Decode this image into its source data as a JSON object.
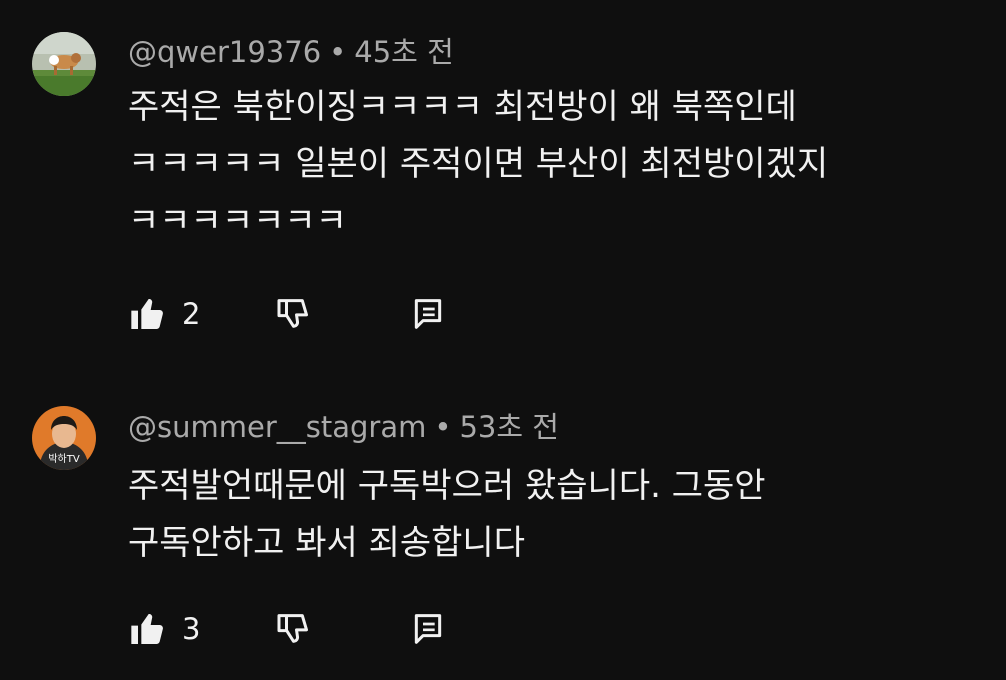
{
  "comments": [
    {
      "author": "@qwer19376",
      "separator": "•",
      "time": "45초 전",
      "lines": [
        "주적은 북한이징ㅋㅋㅋㅋ 최전방이 왜 북쪽인데",
        "ㅋㅋㅋㅋㅋ 일본이 주적이면 부산이 최전방이겠지",
        "ㅋㅋㅋㅋㅋㅋㅋ"
      ],
      "likes": "2",
      "avatar_label": "",
      "icons": [
        "thumbs-up-icon",
        "thumbs-down-icon",
        "reply-icon"
      ]
    },
    {
      "author": "@summer__stagram",
      "separator": "•",
      "time": "53초 전",
      "lines": [
        "주적발언때문에 구독박으러 왔습니다. 그동안",
        "구독안하고 봐서 죄송합니다"
      ],
      "likes": "3",
      "avatar_label": "박하TV",
      "icons": [
        "thumbs-up-icon",
        "thumbs-down-icon",
        "reply-icon"
      ]
    }
  ],
  "colors": {
    "background": "#0f0f0f",
    "text": "#f1f1f1",
    "meta": "#aaaaaa"
  }
}
